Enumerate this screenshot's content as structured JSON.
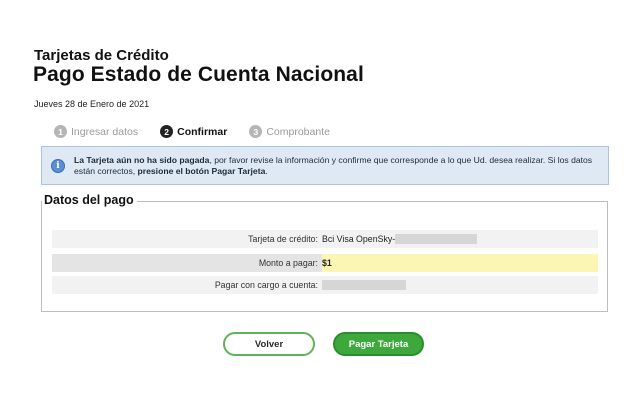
{
  "header": {
    "subtitle": "Tarjetas de Crédito",
    "title": "Pago Estado de Cuenta Nacional",
    "date": "Jueves 28 de Enero de 2021"
  },
  "steps": [
    {
      "num": "1",
      "label": "Ingresar datos",
      "state": "done"
    },
    {
      "num": "2",
      "label": "Confirmar",
      "state": "active"
    },
    {
      "num": "3",
      "label": "Comprobante",
      "state": "pending"
    }
  ],
  "info": {
    "icon": "info-icon",
    "bold1": "La Tarjeta aún no ha sido pagada",
    "text1": ", por favor revise la información y confirme que corresponde a lo que Ud. desea realizar. Si los datos están correctos, ",
    "bold2": "presione el botón Pagar Tarjeta",
    "text2": "."
  },
  "payment": {
    "legend": "Datos del pago",
    "card_label": "Tarjeta de crédito:",
    "card_value": "Bci Visa OpenSky-",
    "amount_label": "Monto a pagar:",
    "amount_value": "$1",
    "account_label": "Pagar con cargo a cuenta:"
  },
  "actions": {
    "back_label": "Volver",
    "pay_label": "Pagar Tarjeta"
  },
  "colors": {
    "pay_button": "#3da83c",
    "info_bg": "#dfe9f4",
    "amount_highlight": "#fbf6b4"
  }
}
